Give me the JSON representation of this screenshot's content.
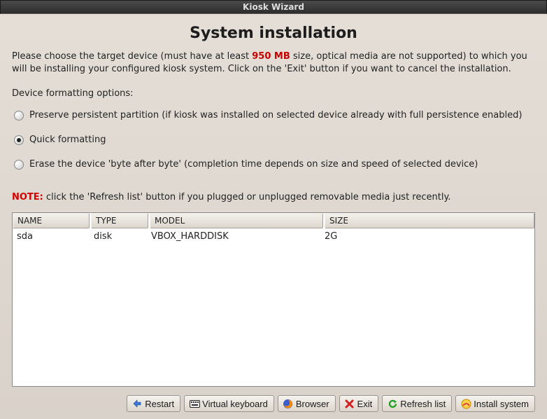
{
  "window": {
    "title": "Kiosk Wizard"
  },
  "heading": "System installation",
  "intro": {
    "before": "Please choose the target device (must have at least ",
    "size": "950 MB",
    "after": " size, optical media are not supported) to which you will be installing your configured kiosk system. Click on the 'Exit' button if you want to cancel the installation."
  },
  "formatting": {
    "label": "Device formatting options:",
    "preserve": "Preserve persistent partition (if kiosk was installed on selected device already with full persistence enabled)",
    "quick": "Quick formatting",
    "erase": "Erase the device 'byte after byte' (completion time depends on size and speed of selected device)",
    "selected": "quick"
  },
  "note": {
    "prefix": "NOTE:",
    "text": " click the 'Refresh list' button if you plugged or unplugged removable media just recently."
  },
  "table": {
    "headers": {
      "name": "NAME",
      "type": "TYPE",
      "model": "MODEL",
      "size": "SIZE"
    },
    "rows": [
      {
        "name": "sda",
        "type": "disk",
        "model": "VBOX_HARDDISK",
        "size": "2G"
      }
    ]
  },
  "buttons": {
    "restart": "Restart",
    "vkeyboard": "Virtual keyboard",
    "browser": "Browser",
    "exit": "Exit",
    "refresh": "Refresh list",
    "install": "Install system"
  }
}
